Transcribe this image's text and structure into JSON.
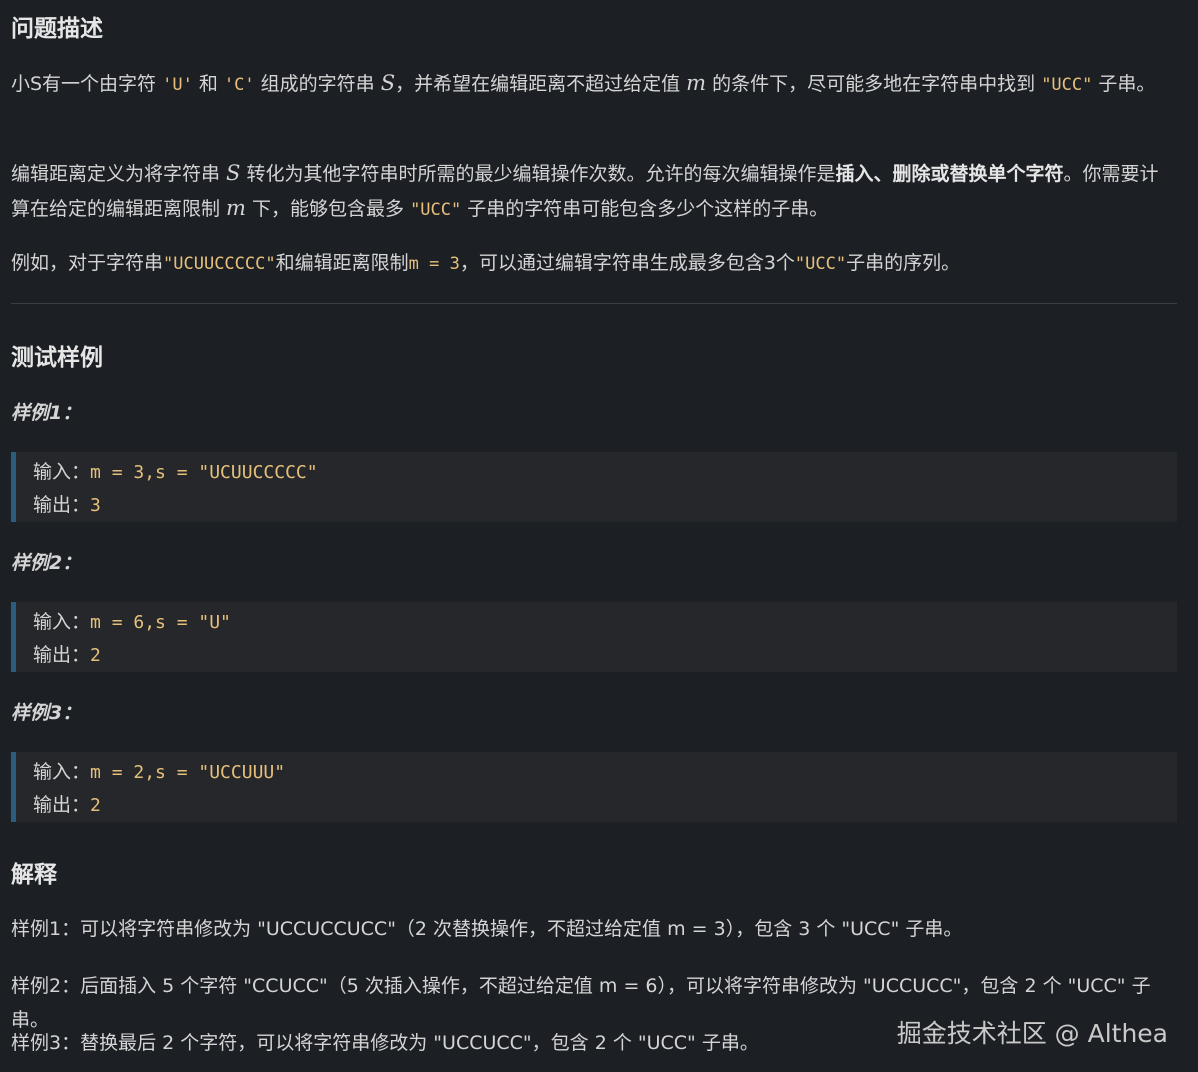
{
  "section_problem": {
    "title": "问题描述",
    "p1": {
      "t1": "小S有一个由字符 ",
      "c1": "'U'",
      "t2": " 和 ",
      "c2": "'C'",
      "t3": " 组成的字符串 ",
      "m1": "S",
      "t4": "，并希望在编辑距离不超过给定值 ",
      "m2": "m",
      "t5": " 的条件下，尽可能多地在字符串中找到 ",
      "c3": "\"UCC\"",
      "t6": " 子串。"
    },
    "p2": {
      "t1": "编辑距离定义为将字符串 ",
      "m1": "S",
      "t2": " 转化为其他字符串时所需的最少编辑操作次数。允许的每次编辑操作是",
      "b1": "插入、删除或替换单个字符",
      "t3": "。你需要计算在给定的编辑距离限制 ",
      "m2": "m",
      "t4": " 下，能够包含最多 ",
      "c1": "\"UCC\"",
      "t5": " 子串的字符串可能包含多少个这样的子串。"
    },
    "p3": {
      "t1": "例如，对于字符串",
      "c1": "\"UCUUCCCCC\"",
      "t2": "和编辑距离限制",
      "c2": "m = 3",
      "t3": "，可以通过编辑字符串生成最多包含3个",
      "c3": "\"UCC\"",
      "t4": "子串的序列。"
    }
  },
  "section_tests": {
    "title": "测试样例",
    "samples": [
      {
        "label": "样例1：",
        "input_label": "输入：",
        "input": "m = 3,s = \"UCUUCCCCC\"",
        "output_label": "输出：",
        "output": "3"
      },
      {
        "label": "样例2：",
        "input_label": "输入：",
        "input": "m = 6,s = \"U\"",
        "output_label": "输出：",
        "output": "2"
      },
      {
        "label": "样例3：",
        "input_label": "输入：",
        "input": "m = 2,s = \"UCCUUU\"",
        "output_label": "输出：",
        "output": "2"
      }
    ]
  },
  "section_explain": {
    "title": "解释",
    "lines": [
      "样例1：可以将字符串修改为 \"UCCUCCUCC\"（2 次替换操作，不超过给定值 m = 3），包含 3 个 \"UCC\" 子串。",
      "样例2：后面插入 5 个字符 \"CCUCC\"（5 次插入操作，不超过给定值 m = 6），可以将字符串修改为 \"UCCUCC\"，包含 2 个 \"UCC\" 子串。",
      "样例3：替换最后 2 个字符，可以将字符串修改为 \"UCCUCC\"，包含 2 个 \"UCC\" 子串。"
    ]
  },
  "watermark": "掘金技术社区 @ Althea"
}
